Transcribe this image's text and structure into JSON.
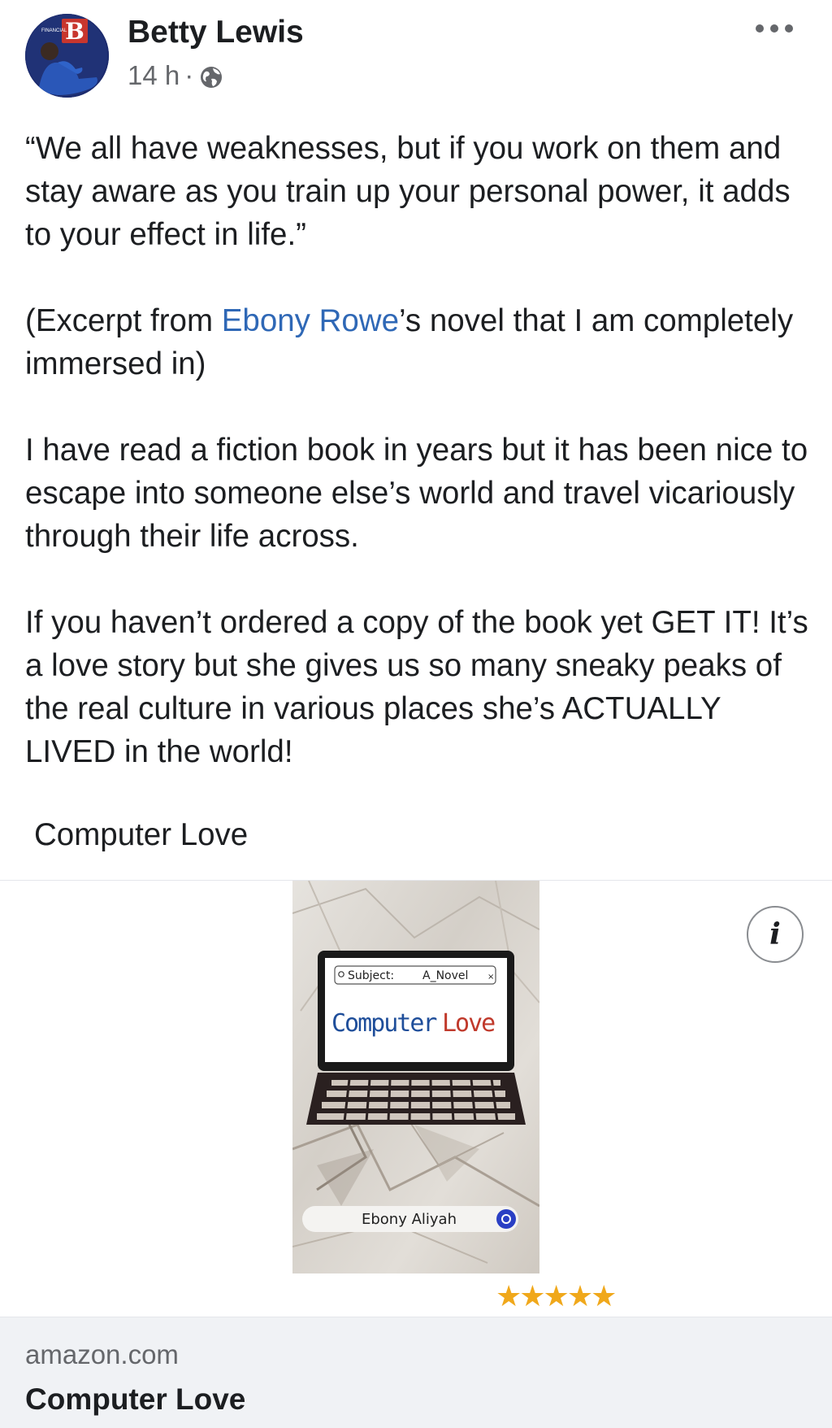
{
  "post": {
    "author": "Betty Lewis",
    "time": "14 h",
    "dot": "·",
    "more_icon": "more-horizontal-icon",
    "privacy_icon": "globe-icon"
  },
  "content": {
    "quote": "“We all have weaknesses, but if you work on them and stay aware as you train up your personal power, it adds to your effect in life.”",
    "excerpt_before": "(Excerpt from ",
    "excerpt_link": "Ebony Rowe",
    "excerpt_after": "’s novel that I am completely immersed in)",
    "para3": "I have read a fiction book in years but it has been nice to escape into someone else’s world and travel vicariously through their life across.",
    "para4": "If you haven’t ordered a copy of the book yet GET IT! It’s a love story but she gives us so many sneaky peaks of the real culture in various places she’s ACTUALLY LIVED in the world!",
    "preview_title": "Computer Love"
  },
  "link_preview": {
    "book": {
      "search_subject": "Subject:",
      "search_query": "A_Novel",
      "search_close": "×",
      "title_word1": "Computer",
      "title_word2": "Love",
      "author": "Ebony Aliyah"
    },
    "info_label": "i",
    "rating_stars": "★★★★★",
    "rating": 5,
    "domain": "amazon.com",
    "title": "Computer Love"
  },
  "colors": {
    "link": "#2f68b6",
    "meta": "#65676b",
    "star": "#f0a81b",
    "cover_title_blue": "#1f4e9a",
    "cover_title_red": "#c0392b"
  }
}
